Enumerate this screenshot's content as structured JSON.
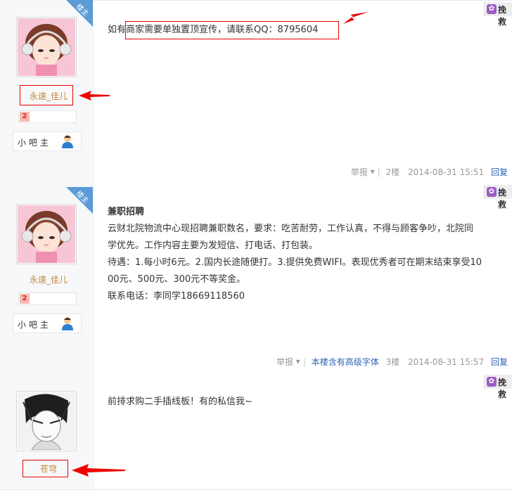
{
  "actions": {
    "save_label": "挽救"
  },
  "posts": [
    {
      "username": "永遠_佳儿",
      "role": "小吧主",
      "badge": "楼主",
      "level": "2",
      "lines": [
        "如有商家需要单独置顶宣传，请联系QQ：8795604"
      ],
      "report": "举报",
      "floor": "2楼",
      "datetime": "2014-08-31 15:51",
      "reply": "回复"
    },
    {
      "username": "永遠_佳儿",
      "role": "小吧主",
      "badge": "楼主",
      "level": "2",
      "title": "兼职招聘",
      "lines": [
        "云财北院物流中心现招聘兼职数名，要求：吃苦耐劳，工作认真，不得与顾客争吵，北院同",
        "学优先。工作内容主要为发短信、打电话、打包装。",
        "待遇：1.每小时6元。2.国内长途随便打。3.提供免费WIFI。表现优秀者可在期末结束享受10",
        "00元、500元、300元不等奖金。",
        "联系电话：李同学18669118560"
      ],
      "report": "举报",
      "font_notice": "本楼含有高级字体",
      "floor": "3楼",
      "datetime": "2014-08-31 15:57",
      "reply": "回复"
    },
    {
      "username": "苍穹",
      "lines": [
        "前排求购二手插线板！有的私信我~"
      ]
    }
  ],
  "colors": {
    "accent_blue": "#2d64b3",
    "username_gold": "#c48a3c",
    "annotation_red": "#e00000",
    "badge_blue": "#5b9bd6",
    "save_purple": "#9b5cc4"
  }
}
